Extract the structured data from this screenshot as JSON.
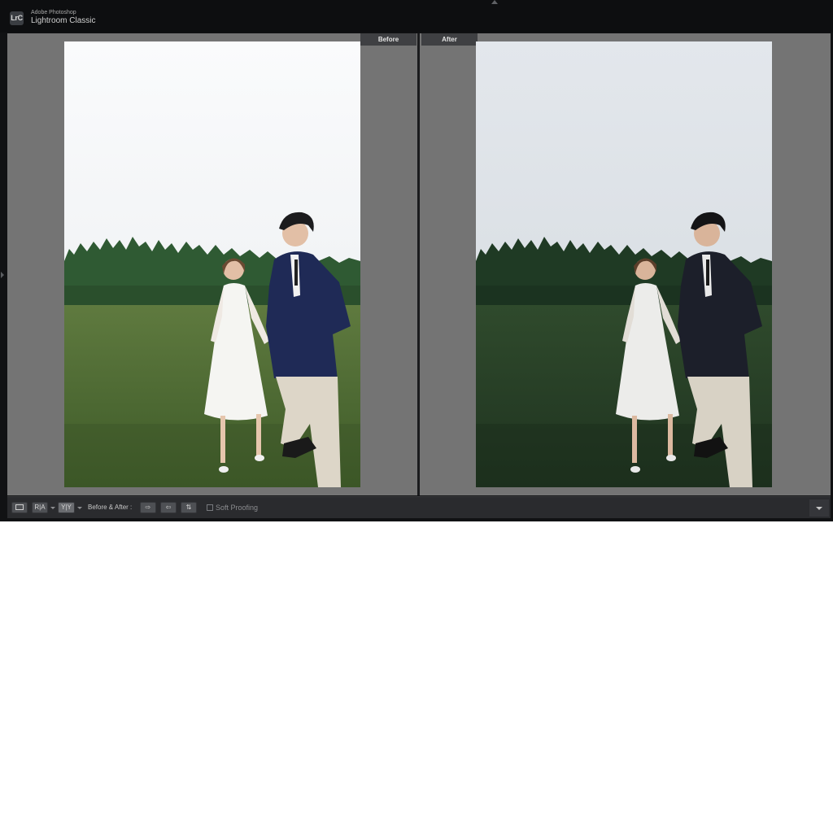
{
  "app": {
    "logo_text": "LrC",
    "brand_top": "Adobe Photoshop",
    "brand_name": "Lightroom Classic"
  },
  "compare": {
    "before_label": "Before",
    "after_label": "After",
    "before_photo_desc": "wedding-couple-before",
    "after_photo_desc": "wedding-couple-after"
  },
  "toolbar": {
    "view_loupe_icon": "loupe-view-icon",
    "view_compare_label": "R|A",
    "view_before_after_label": "Y|Y",
    "before_after_label": "Before & After :",
    "copy_settings_before_to_after_icon": "copy-before-to-after-icon",
    "copy_settings_after_to_before_icon": "copy-after-to-before-icon",
    "swap_icon": "swap-icon",
    "soft_proofing_label": "Soft Proofing",
    "soft_proofing_checked": false
  },
  "colors": {
    "app_bg": "#111214",
    "pane_bg": "#747474",
    "toolbar_bg": "#2a2b2e",
    "label_bg": "#3f4043"
  }
}
